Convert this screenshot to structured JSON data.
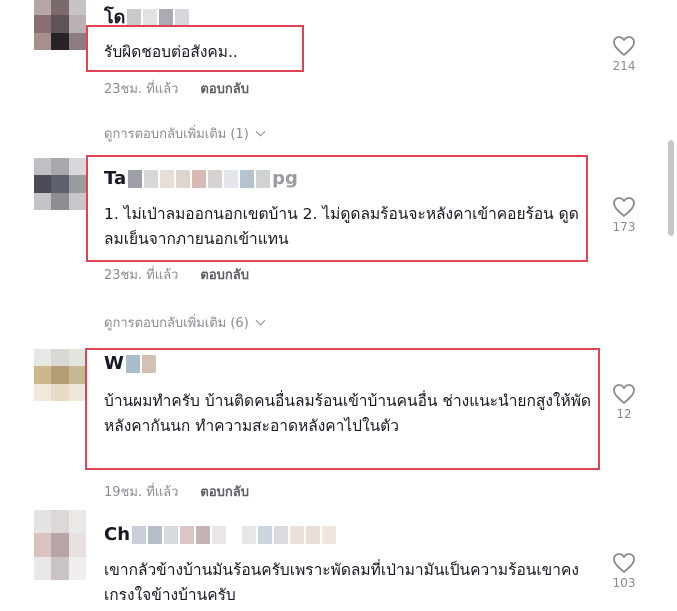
{
  "comments": [
    {
      "name": "โด",
      "text": "รับผิดชอบต่อสังคม..",
      "time": "23ชม. ที่แล้ว",
      "reply": "ตอบกลับ",
      "likes": "214",
      "more_replies": "ดูการตอบกลับเพิ่มเติม (1)"
    },
    {
      "name": "Ta",
      "name_tail": "pg",
      "text": "1. ไม่เป่าลมออกนอกเขตบ้าน 2. ไม่ดูดลมร้อนจะหลังคาเข้าคอยร้อน ดูดลมเย็นจากภายนอกเข้าแทน",
      "time": "23ชม. ที่แล้ว",
      "reply": "ตอบกลับ",
      "likes": "173",
      "more_replies": "ดูการตอบกลับเพิ่มเติม (6)"
    },
    {
      "name": "W",
      "text": "บ้านผมทำครับ บ้านติดคนอื่นลมร้อนเข้าบ้านคนอื่น ช่างแนะนำยกสูงให้พัดหลังคากันนก ทำความสะอาดหลังคาไปในตัว",
      "time": "19ชม. ที่แล้ว",
      "reply": "ตอบกลับ",
      "likes": "12"
    },
    {
      "name": "Ch",
      "text": "เขากลัวข้างบ้านมันร้อนครับเพราะพัดลมที่เป่ามามันเป็นความร้อนเขาคงเกรงใจข้างบ้านครับ",
      "likes": "103"
    }
  ],
  "icons": {
    "like": "heart-outline-icon",
    "expand": "chevron-down-icon"
  },
  "colors": {
    "highlight": "#e04354",
    "meta": "#8a8b91"
  }
}
